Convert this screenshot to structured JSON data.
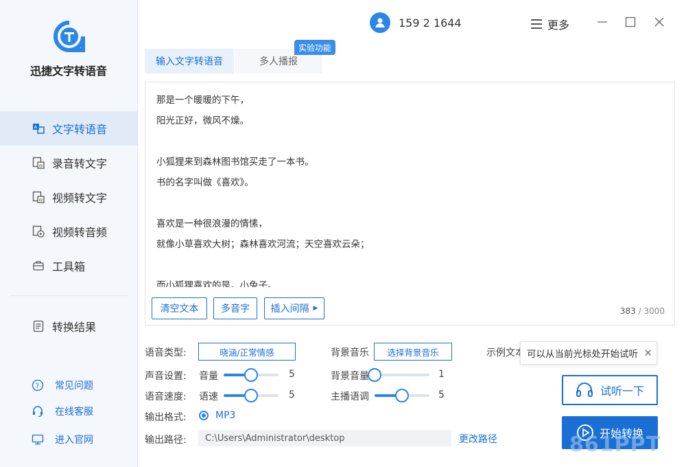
{
  "app": {
    "name": "迅捷文字转语音"
  },
  "user": {
    "phone": "159 2 1644"
  },
  "header": {
    "more_label": "更多"
  },
  "nav": {
    "items": [
      {
        "label": "文字转语音"
      },
      {
        "label": "录音转文字"
      },
      {
        "label": "视频转文字"
      },
      {
        "label": "视频转音频"
      },
      {
        "label": "工具箱"
      },
      {
        "label": "转换结果"
      }
    ]
  },
  "help": {
    "items": [
      {
        "label": "常见问题"
      },
      {
        "label": "在线客服"
      },
      {
        "label": "进入官网"
      }
    ]
  },
  "tabs": [
    {
      "label": "输入文字转语音"
    },
    {
      "label": "多人播报"
    }
  ],
  "badge": {
    "experimental": "实验功能"
  },
  "editor": {
    "lines": [
      "那是一个暖暖的下午，",
      "阳光正好，微风不燥。",
      "",
      "小狐狸来到森林图书馆买走了一本书。",
      "书的名字叫做《喜欢》。",
      "",
      "喜欢是一种很浪漫的情愫，",
      "就像小草喜欢大树；森林喜欢河流；天空喜欢云朵；",
      "",
      "而小狐狸喜欢的是，小兔子。"
    ],
    "count": "383",
    "max": "/ 3000"
  },
  "editor_buttons": {
    "clear": "清空文本",
    "polyphone": "多音字",
    "insert_pause": "插入间隔"
  },
  "settings": {
    "voice_type_label": "语音类型:",
    "voice_type_value": "晓涵/正常情感",
    "bgm_label": "背景音乐",
    "bgm_button": "选择背景音乐",
    "sample_label": "示例文本",
    "sound_label": "声音设置:",
    "volume_label": "音量",
    "volume_value": "5",
    "volume_level": 0.5,
    "bg_volume_label": "背景音量",
    "bg_volume_value": "1",
    "bg_volume_level": 0.0,
    "speed_label": "语音速度:",
    "speed_sublabel": "语速",
    "speed_value": "5",
    "speed_level": 0.5,
    "pitch_label": "主播语调",
    "pitch_value": "5",
    "pitch_level": 0.5,
    "format_label": "输出格式:",
    "format_value": "MP3",
    "path_label": "输出路径:",
    "path_value": "C:\\Users\\Administrator\\desktop",
    "change_path": "更改路径"
  },
  "actions": {
    "tooltip": "可以从当前光标处开始试听",
    "listen": "试听一下",
    "start": "开始转换"
  },
  "watermark": {
    "text": "861PPT"
  },
  "colors": {
    "accent": "#1a6fd4",
    "sidebar_bg": "#f4f7fb",
    "active_nav_bg": "#e1ebf7"
  }
}
